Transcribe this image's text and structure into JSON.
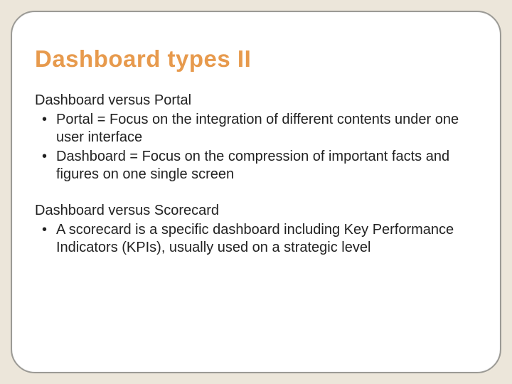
{
  "title": "Dashboard types II",
  "sections": [
    {
      "heading": "Dashboard versus Portal",
      "bullets": [
        "Portal = Focus on the integration of different contents under one user interface",
        "Dashboard = Focus on the compression of important facts and figures on one single screen"
      ]
    },
    {
      "heading": "Dashboard versus Scorecard",
      "bullets": [
        "A scorecard is a specific dashboard  including Key Performance Indicators (KPIs), usually used on a strategic level"
      ]
    }
  ]
}
